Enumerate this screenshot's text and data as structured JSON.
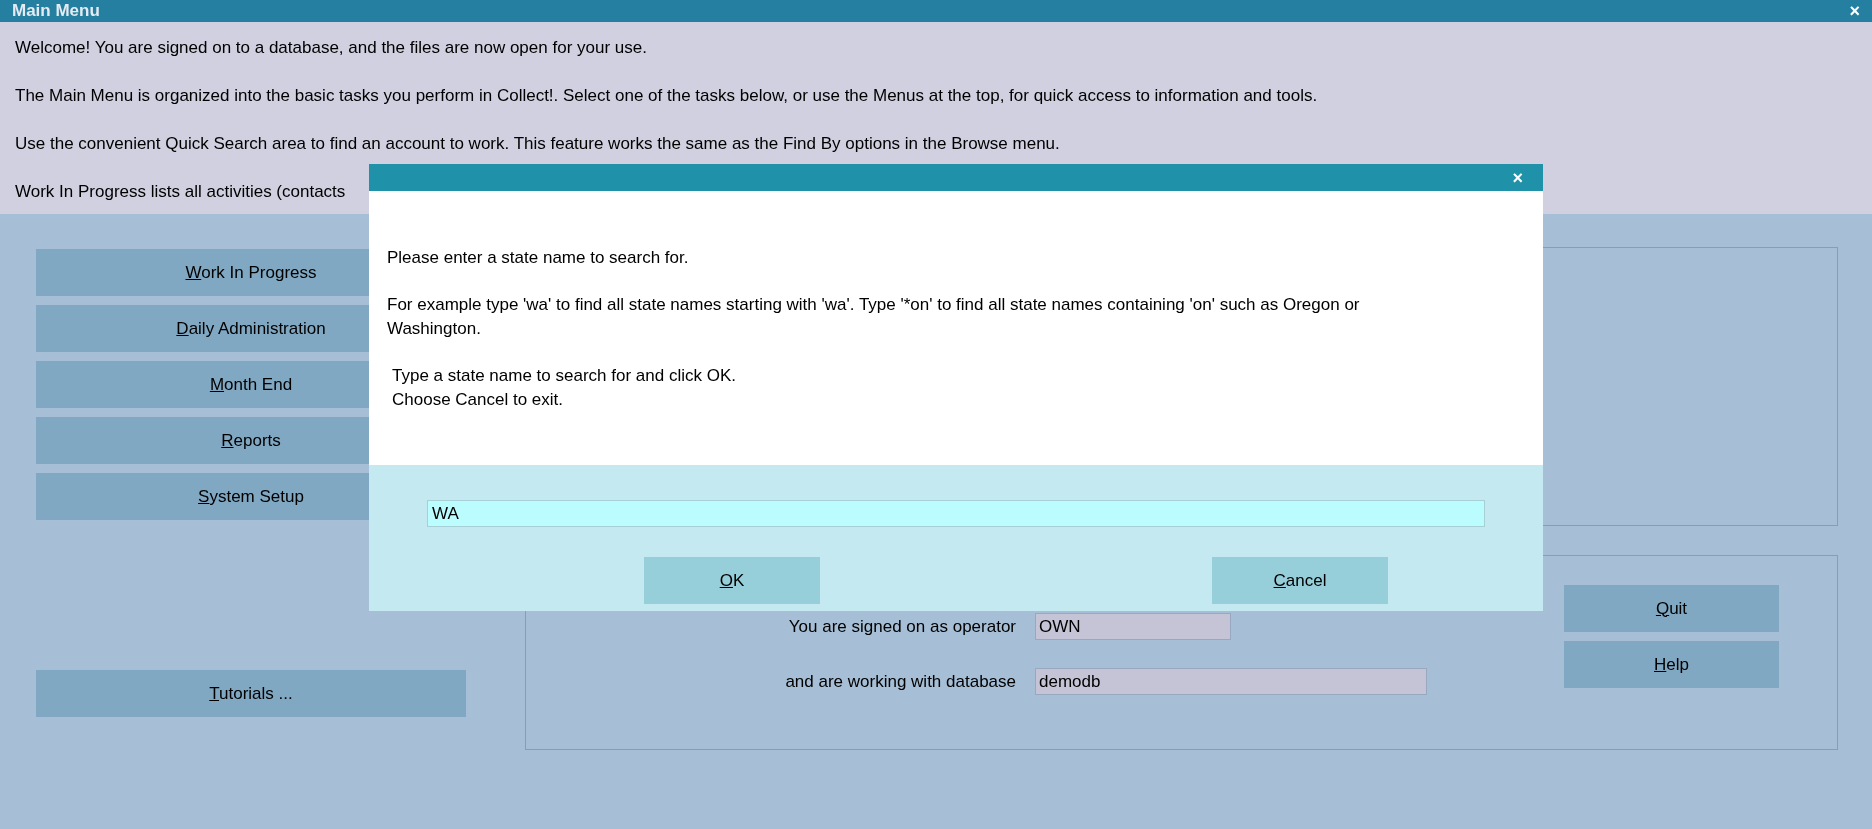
{
  "window": {
    "title": "Main Menu",
    "close": "×"
  },
  "intro": [
    "Welcome! You are signed on to a database, and the files are now open for your use.",
    "The Main Menu is organized into the basic tasks you perform in Collect!. Select one of the tasks below, or use the Menus at the top, for quick access to information and tools.",
    "Use the convenient Quick Search area to find an account to work. This feature works the same as the Find By options in the Browse menu.",
    "Work In Progress lists all activities (contacts"
  ],
  "task_buttons": [
    {
      "key": "W",
      "rest": "ork In Progress"
    },
    {
      "key": "D",
      "rest": "aily Administration"
    },
    {
      "key": "M",
      "rest": "onth End"
    },
    {
      "key": "R",
      "rest": "eports"
    },
    {
      "key": "S",
      "rest": "ystem Setup"
    }
  ],
  "tutorials_button": {
    "key": "T",
    "rest": "utorials ..."
  },
  "session": [
    {
      "label": "You are signed on as operator",
      "value": "OWN"
    },
    {
      "label": "and are working with database",
      "value": "demodb"
    }
  ],
  "side_buttons": [
    {
      "key": "Q",
      "rest": "uit"
    },
    {
      "key": "H",
      "rest": "elp"
    }
  ],
  "dialog": {
    "close": "×",
    "message": [
      "Please enter a state name to search for.",
      "For example type 'wa' to find all state names starting with 'wa'. Type '*on' to find all state names containing 'on' such as Oregon or Washington."
    ],
    "instructions": [
      "Type a state name to search for and click OK.",
      "Choose Cancel to exit."
    ],
    "input": {
      "value": "WA"
    },
    "buttons": [
      {
        "key": "O",
        "rest": "K"
      },
      {
        "key": "C",
        "rest": "ancel"
      }
    ]
  }
}
